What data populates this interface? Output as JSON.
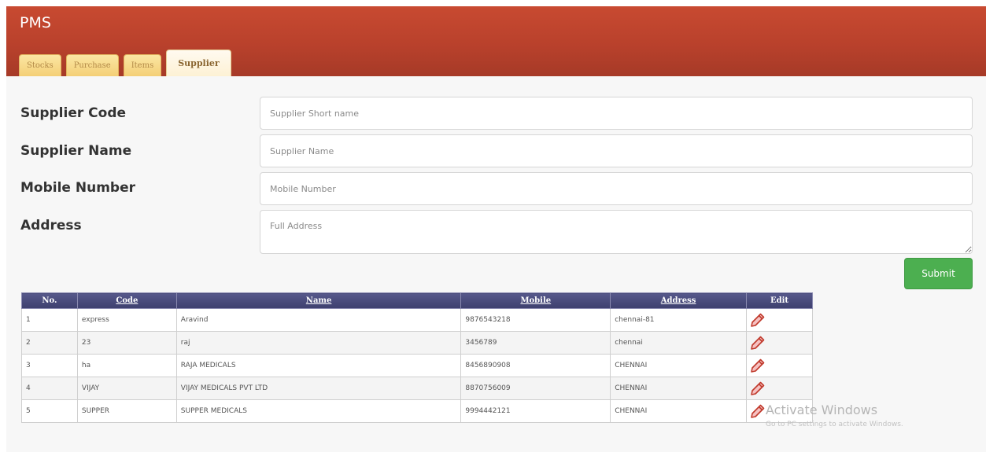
{
  "app": {
    "title": "PMS"
  },
  "tabs": [
    {
      "label": "Stocks"
    },
    {
      "label": "Purchase"
    },
    {
      "label": "Items"
    },
    {
      "label": "Supplier"
    }
  ],
  "form": {
    "code_label": "Supplier Code",
    "code_placeholder": "Supplier Short name",
    "name_label": "Supplier Name",
    "name_placeholder": "Supplier Name",
    "mobile_label": "Mobile Number",
    "mobile_placeholder": "Mobile Number",
    "address_label": "Address",
    "address_placeholder": "Full Address",
    "submit_label": "Submit"
  },
  "table": {
    "headers": [
      "No.",
      "Code",
      "Name",
      "Mobile",
      "Address",
      "Edit"
    ],
    "rows": [
      {
        "no": "1",
        "code": "express",
        "name": "Aravind",
        "mobile": "9876543218",
        "address": "chennai-81"
      },
      {
        "no": "2",
        "code": "23",
        "name": "raj",
        "mobile": "3456789",
        "address": "chennai"
      },
      {
        "no": "3",
        "code": "ha",
        "name": "RAJA MEDICALS",
        "mobile": "8456890908",
        "address": "CHENNAI"
      },
      {
        "no": "4",
        "code": "VIJAY",
        "name": "VIJAY MEDICALS PVT LTD",
        "mobile": "8870756009",
        "address": "CHENNAI"
      },
      {
        "no": "5",
        "code": "SUPPER",
        "name": "SUPPER MEDICALS",
        "mobile": "9994442121",
        "address": "CHENNAI"
      }
    ]
  },
  "watermark": {
    "line1": "Activate Windows",
    "line2": "Go to PC settings to activate Windows."
  },
  "icons": {
    "edit": "pencil-icon"
  },
  "colors": {
    "header": "#b9412c",
    "tab": "#f4cf76",
    "table_header": "#464877",
    "submit": "#4caf50"
  }
}
